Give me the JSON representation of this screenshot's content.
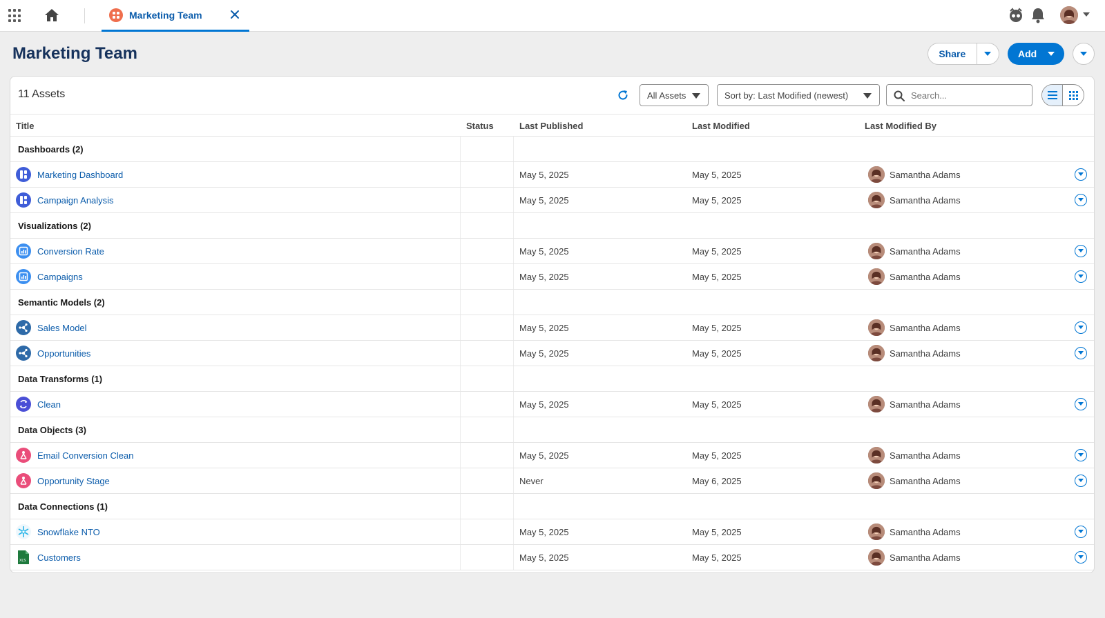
{
  "tab": {
    "label": "Marketing Team"
  },
  "page": {
    "title": "Marketing Team"
  },
  "actions": {
    "share_label": "Share",
    "add_label": "Add"
  },
  "toolbar": {
    "count": "11 Assets",
    "filter_value": "All Assets",
    "sort_value": "Sort by: Last Modified (newest)",
    "search_placeholder": "Search..."
  },
  "columns": {
    "title": "Title",
    "status": "Status",
    "last_published": "Last Published",
    "last_modified": "Last Modified",
    "last_modified_by": "Last Modified By"
  },
  "groups": [
    {
      "title": "Dashboards (2)",
      "icon": "dashboard-icon",
      "color": "#3f5dd8",
      "items": [
        {
          "title": "Marketing Dashboard",
          "status": "",
          "published": "May 5, 2025",
          "modified": "May 5, 2025",
          "by": "Samantha Adams"
        },
        {
          "title": "Campaign Analysis",
          "status": "",
          "published": "May 5, 2025",
          "modified": "May 5, 2025",
          "by": "Samantha Adams"
        }
      ]
    },
    {
      "title": "Visualizations (2)",
      "icon": "visualization-icon",
      "color": "#3c8ff0",
      "items": [
        {
          "title": "Conversion Rate",
          "status": "",
          "published": "May 5, 2025",
          "modified": "May 5, 2025",
          "by": "Samantha Adams"
        },
        {
          "title": "Campaigns",
          "status": "",
          "published": "May 5, 2025",
          "modified": "May 5, 2025",
          "by": "Samantha Adams"
        }
      ]
    },
    {
      "title": "Semantic Models (2)",
      "icon": "semantic-model-icon",
      "color": "#2e6aa8",
      "items": [
        {
          "title": "Sales Model",
          "status": "",
          "published": "May 5, 2025",
          "modified": "May 5, 2025",
          "by": "Samantha Adams"
        },
        {
          "title": "Opportunities",
          "status": "",
          "published": "May 5, 2025",
          "modified": "May 5, 2025",
          "by": "Samantha Adams"
        }
      ]
    },
    {
      "title": "Data Transforms (1)",
      "icon": "data-transform-icon",
      "color": "#4a4fd6",
      "items": [
        {
          "title": "Clean",
          "status": "",
          "published": "May 5, 2025",
          "modified": "May 5, 2025",
          "by": "Samantha Adams"
        }
      ]
    },
    {
      "title": "Data Objects (3)",
      "icon": "data-object-icon",
      "color": "#ea4d7a",
      "items": [
        {
          "title": "Email Conversion Clean",
          "status": "",
          "published": "May 5, 2025",
          "modified": "May 5, 2025",
          "by": "Samantha Adams"
        },
        {
          "title": "Opportunity Stage",
          "status": "",
          "published": "Never",
          "modified": "May 6, 2025",
          "by": "Samantha Adams"
        }
      ]
    },
    {
      "title": "Data Connections (1)",
      "icon": "snowflake-icon",
      "color": "#29b5e8",
      "items": [
        {
          "title": "Snowflake NTO",
          "status": "",
          "published": "May 5, 2025",
          "modified": "May 5, 2025",
          "by": "Samantha Adams"
        },
        {
          "title": "Customers",
          "status": "",
          "published": "May 5, 2025",
          "modified": "May 5, 2025",
          "by": "Samantha Adams",
          "icon": "spreadsheet-icon",
          "color": "#1e7a3d"
        }
      ]
    }
  ],
  "colors": {
    "accent": "#0176d3",
    "link": "#0b5cab",
    "title": "#16325c"
  }
}
